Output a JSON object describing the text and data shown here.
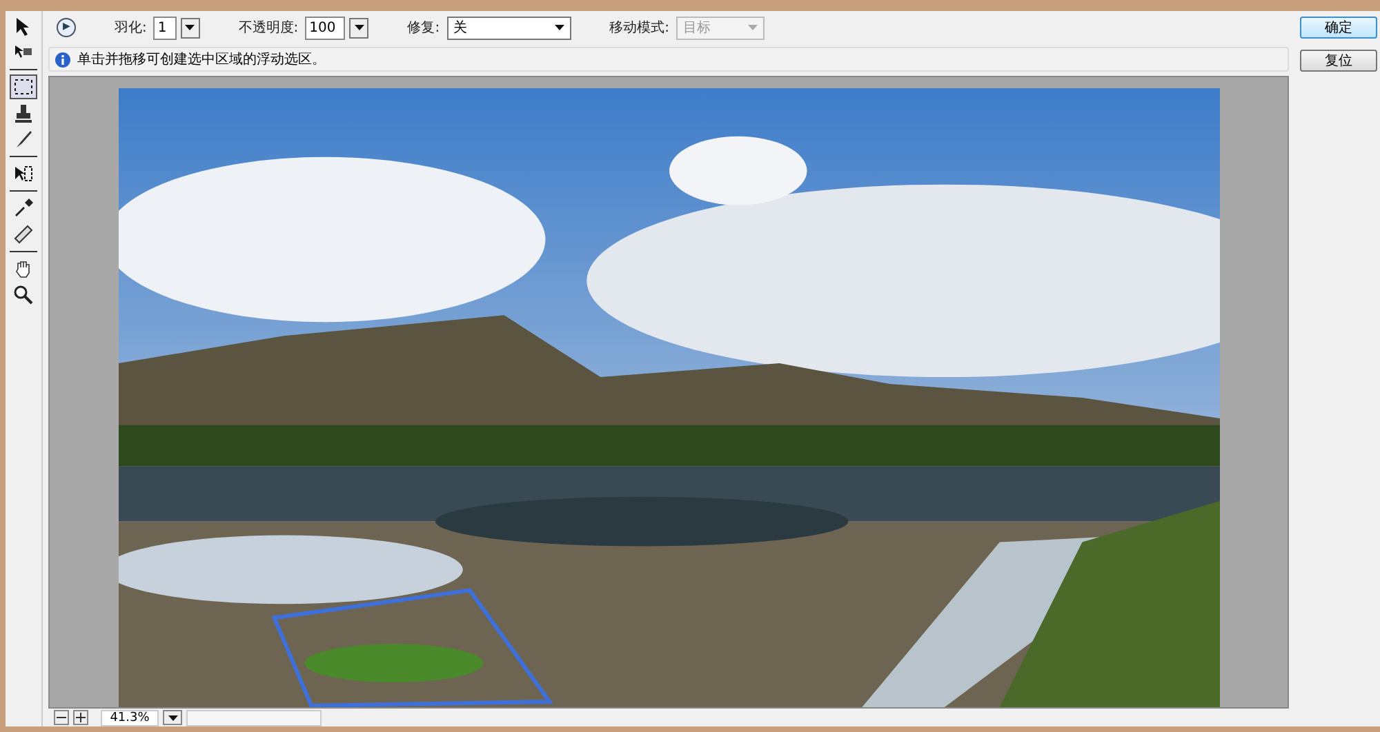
{
  "toolbar": {
    "play_button": "▶",
    "fields": [
      {
        "kind": "spin",
        "label": "羽化:",
        "value": "1",
        "disabled": false
      },
      {
        "kind": "spin",
        "label": "不透明度:",
        "value": "100",
        "disabled": false
      },
      {
        "kind": "select",
        "label": "修复:",
        "value": "关",
        "disabled": false
      },
      {
        "kind": "select",
        "label": "移动模式:",
        "value": "目标",
        "disabled": true
      }
    ]
  },
  "hint": "单击并拖移可创建选中区域的浮动选区。",
  "buttons": [
    {
      "label": "确定",
      "default": true
    },
    {
      "label": "复位",
      "default": false
    }
  ],
  "tools": [
    {
      "kind": "arrow",
      "selected": false
    },
    {
      "kind": "plane",
      "selected": false
    },
    {
      "kind": "marquee",
      "selected": true
    },
    {
      "kind": "stamp",
      "selected": false
    },
    {
      "kind": "brush",
      "selected": false
    },
    {
      "kind": "transform",
      "selected": false
    },
    {
      "kind": "eyedropper",
      "selected": false
    },
    {
      "kind": "ruler",
      "selected": false
    },
    {
      "kind": "hand",
      "selected": false
    },
    {
      "kind": "zoom",
      "selected": false
    }
  ],
  "status_bar": {
    "zoom": "41.3%"
  }
}
